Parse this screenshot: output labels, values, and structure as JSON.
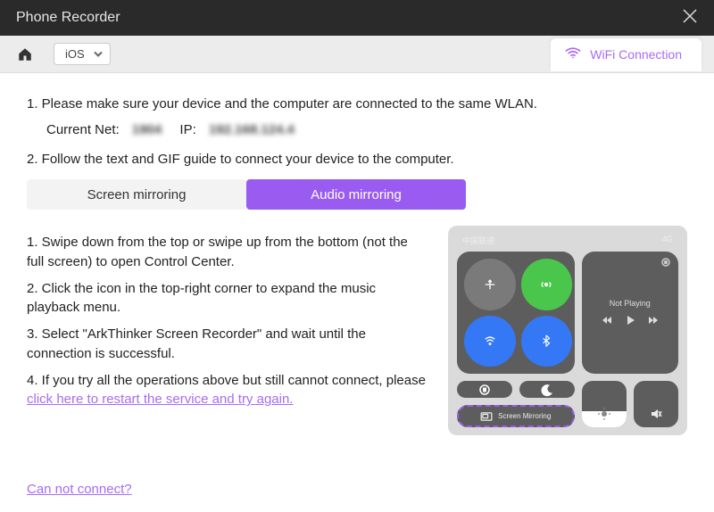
{
  "titlebar": {
    "title": "Phone Recorder"
  },
  "toolbar": {
    "os_selected": "iOS",
    "wifi_tab": "WiFi Connection"
  },
  "instructions": {
    "step1": "1. Please make sure your device and the computer are connected to the same WLAN.",
    "current_net_label": "Current Net:",
    "current_net_value": "1904",
    "ip_label": "IP:",
    "ip_value": "192.168.124.4",
    "step2": "2. Follow the text and GIF guide to connect your device to the computer."
  },
  "tabs": {
    "screen": "Screen mirroring",
    "audio": "Audio mirroring"
  },
  "guide": {
    "s1": "1. Swipe down from the top or swipe up from the bottom (not the full screen) to open Control Center.",
    "s2": "2. Click the icon in the top-right corner to expand the music playback menu.",
    "s3": "3. Select \"ArkThinker Screen Recorder\" and wait until the connection is successful.",
    "s4a": "4. If you try all the operations above but still cannot connect, please ",
    "s4b": "click here to restart the service and try again."
  },
  "phone": {
    "carrier": "中国联通",
    "signal": "4G",
    "not_playing": "Not Playing",
    "screen_mirroring": "Screen Mirroring"
  },
  "footer": {
    "cant_connect": "Can not connect?"
  }
}
